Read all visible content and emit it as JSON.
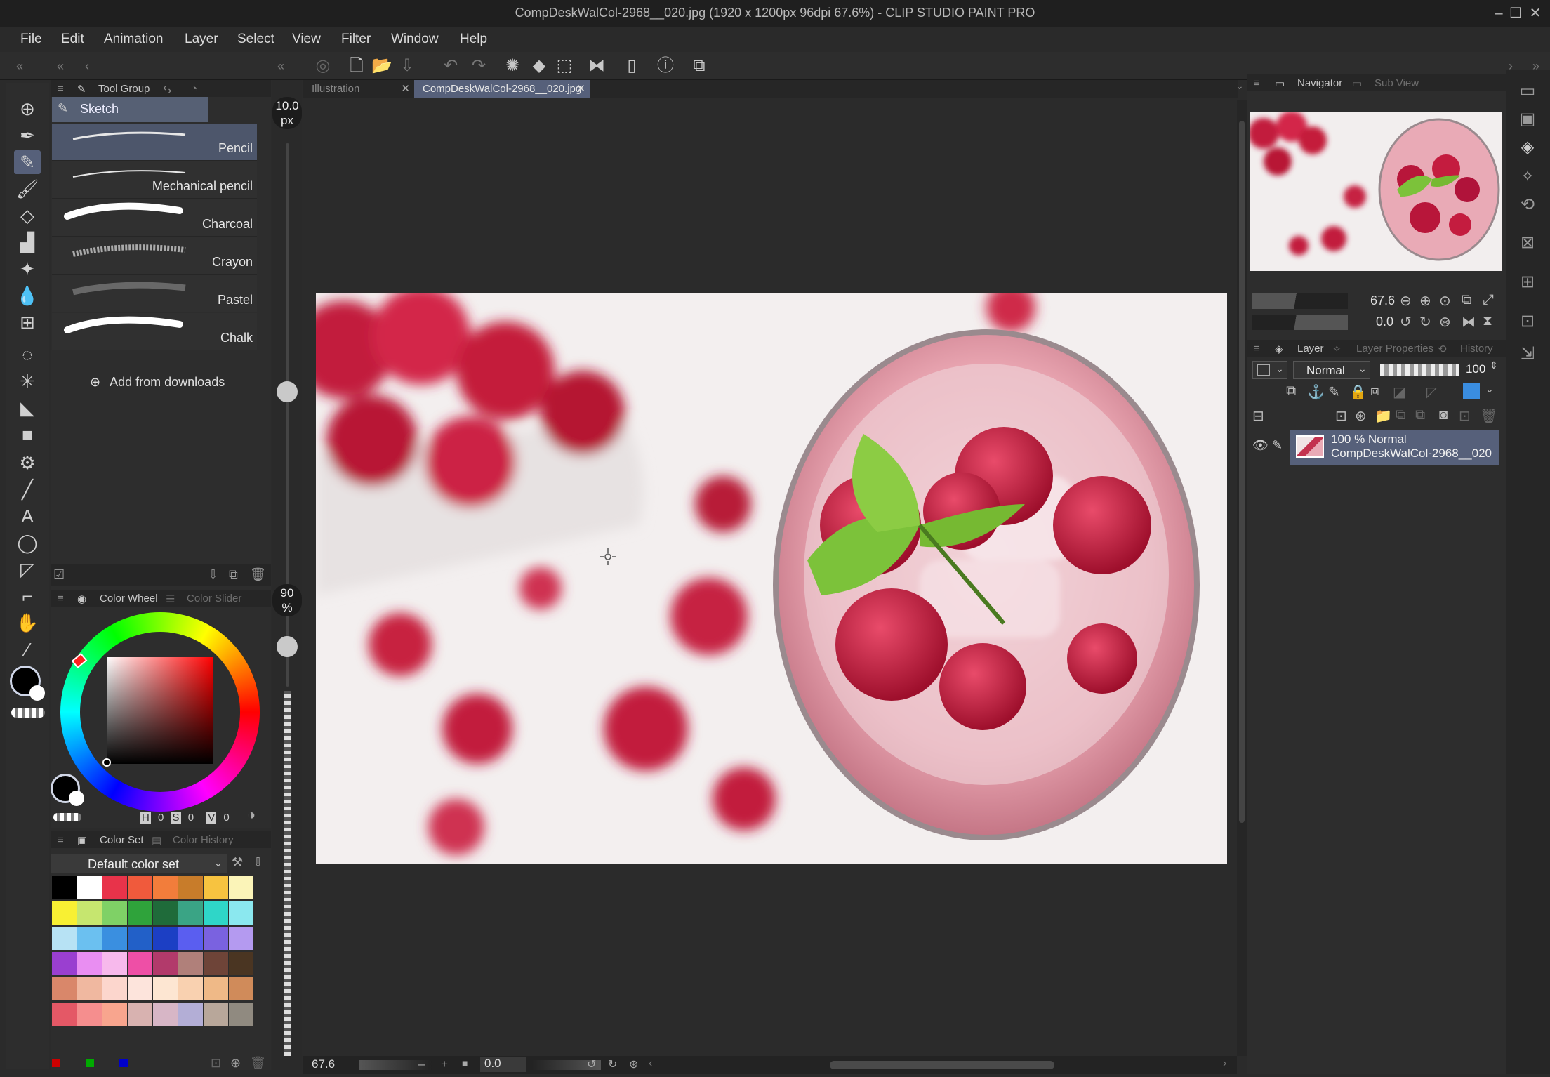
{
  "window": {
    "title": "CompDeskWalCol-2968__020.jpg (1920 x 1200px 96dpi 67.6%)  - CLIP STUDIO PAINT PRO"
  },
  "menu": [
    "File",
    "Edit",
    "Animation",
    "Layer",
    "Select",
    "View",
    "Filter",
    "Window",
    "Help"
  ],
  "subtool": {
    "header_tab": "Tool Group",
    "group_label": "Sketch",
    "brushes": [
      "Pencil",
      "Mechanical pencil",
      "Charcoal",
      "Crayon",
      "Pastel",
      "Chalk"
    ],
    "selected": "Pencil",
    "add_label": "Add from downloads"
  },
  "brush_size": {
    "value": "10.0",
    "unit": "px",
    "level": 0.41
  },
  "brush_opacity": {
    "value": "90",
    "unit": "%",
    "level": 0.9
  },
  "color_wheel": {
    "tab_active": "Color Wheel",
    "tab_inactive": "Color Slider",
    "h_label": "H",
    "h_value": "0",
    "s_label": "S",
    "s_value": "0",
    "v_label": "V",
    "v_value": "0",
    "main_color": "#000000",
    "sub_color": "#ffffff"
  },
  "color_set": {
    "tab_active": "Color Set",
    "tab_inactive": "Color History",
    "set_name": "Default color set",
    "swatches": [
      "#000000",
      "#ffffff",
      "#e8334a",
      "#f05a3c",
      "#f27d3b",
      "#c87c2a",
      "#f7c340",
      "#fbf4b8",
      "#f8f033",
      "#c6e66f",
      "#7fd166",
      "#2fa33b",
      "#1f6b3a",
      "#3aa485",
      "#2fd6c8",
      "#8be8ef",
      "#b7e2f4",
      "#6bc0f0",
      "#3a8fe0",
      "#2260c8",
      "#1c3fc4",
      "#5a5ef0",
      "#7a62e0",
      "#b49af0",
      "#9a3fd0",
      "#e98ef2",
      "#f7b9ec",
      "#ee4fa6",
      "#b23a6b",
      "#b0807a",
      "#6e4438",
      "#4a3522",
      "#d9876a",
      "#f0b8a0",
      "#fcd6cd",
      "#fde4dc",
      "#fde6d2",
      "#f9d1b0",
      "#efb987",
      "#d08b5a",
      "#e45866",
      "#f58e8e",
      "#f8a58e",
      "#d8b2b0",
      "#d7b6c6",
      "#b3aed6",
      "#b8a79a",
      "#908a80"
    ]
  },
  "doc_tabs": {
    "inactive": "Illustration",
    "active": "CompDeskWalCol-2968__020.jpg"
  },
  "status": {
    "zoom": "67.6",
    "angle": "0.0"
  },
  "navigator": {
    "tab_active": "Navigator",
    "tab_inactive": "Sub View",
    "zoom": "67.6",
    "rotation": "0.0"
  },
  "layer_panel": {
    "tab_active": "Layer",
    "tab_props": "Layer Properties",
    "tab_history": "History",
    "blend_mode": "Normal",
    "opacity": "100",
    "layers": [
      {
        "line1": "100 % Normal",
        "line2": "CompDeskWalCol-2968__020"
      }
    ]
  }
}
